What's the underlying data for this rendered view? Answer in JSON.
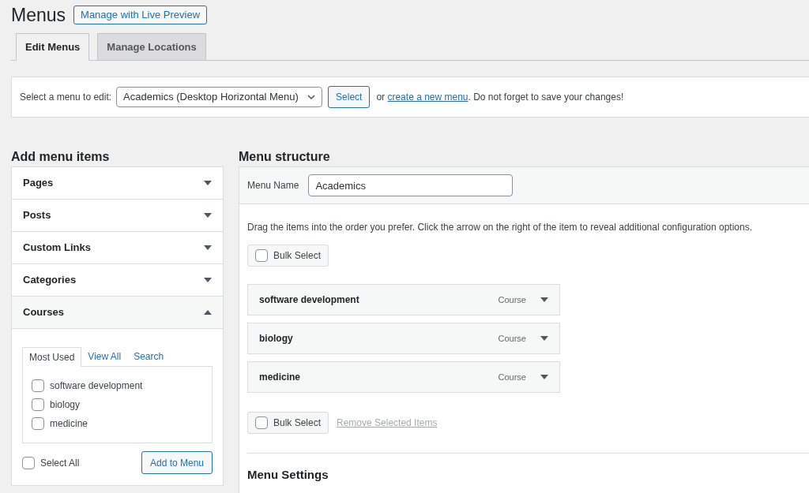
{
  "page": {
    "title": "Menus",
    "live_preview_button": "Manage with Live Preview"
  },
  "tabs": [
    {
      "label": "Edit Menus",
      "selected": true
    },
    {
      "label": "Manage Locations",
      "selected": false
    }
  ],
  "menu_select": {
    "label": "Select a menu to edit:",
    "value": "Academics (Desktop Horizontal Menu)",
    "button": "Select",
    "text_before_link": "or",
    "link": "create a new menu",
    "text_after_link": ". Do not forget to save your changes!"
  },
  "add_menu_items": {
    "title": "Add menu items",
    "sections": [
      {
        "label": "Pages",
        "expanded": false
      },
      {
        "label": "Posts",
        "expanded": false
      },
      {
        "label": "Custom Links",
        "expanded": false
      },
      {
        "label": "Categories",
        "expanded": false
      },
      {
        "label": "Courses",
        "expanded": true,
        "tabs": [
          {
            "label": "Most Used",
            "selected": true
          },
          {
            "label": "View All",
            "selected": false
          },
          {
            "label": "Search",
            "selected": false
          }
        ],
        "items": [
          {
            "label": "software development",
            "checked": false
          },
          {
            "label": "biology",
            "checked": false
          },
          {
            "label": "medicine",
            "checked": false
          }
        ],
        "select_all": {
          "label": "Select All",
          "checked": false
        },
        "add_button": "Add to Menu"
      }
    ]
  },
  "menu_structure": {
    "title": "Menu structure",
    "menu_name_label": "Menu Name",
    "menu_name": "Academics",
    "instructions": "Drag the items into the order you prefer. Click the arrow on the right of the item to reveal additional configuration options.",
    "bulk_select_top": {
      "label": "Bulk Select",
      "checked": false
    },
    "items": [
      {
        "title": "software development",
        "type": "Course"
      },
      {
        "title": "biology",
        "type": "Course"
      },
      {
        "title": "medicine",
        "type": "Course"
      }
    ],
    "bulk_select_bottom": {
      "label": "Bulk Select",
      "checked": false
    },
    "remove_link": {
      "label": "Remove Selected Items",
      "disabled": true
    },
    "settings_title": "Menu Settings"
  }
}
